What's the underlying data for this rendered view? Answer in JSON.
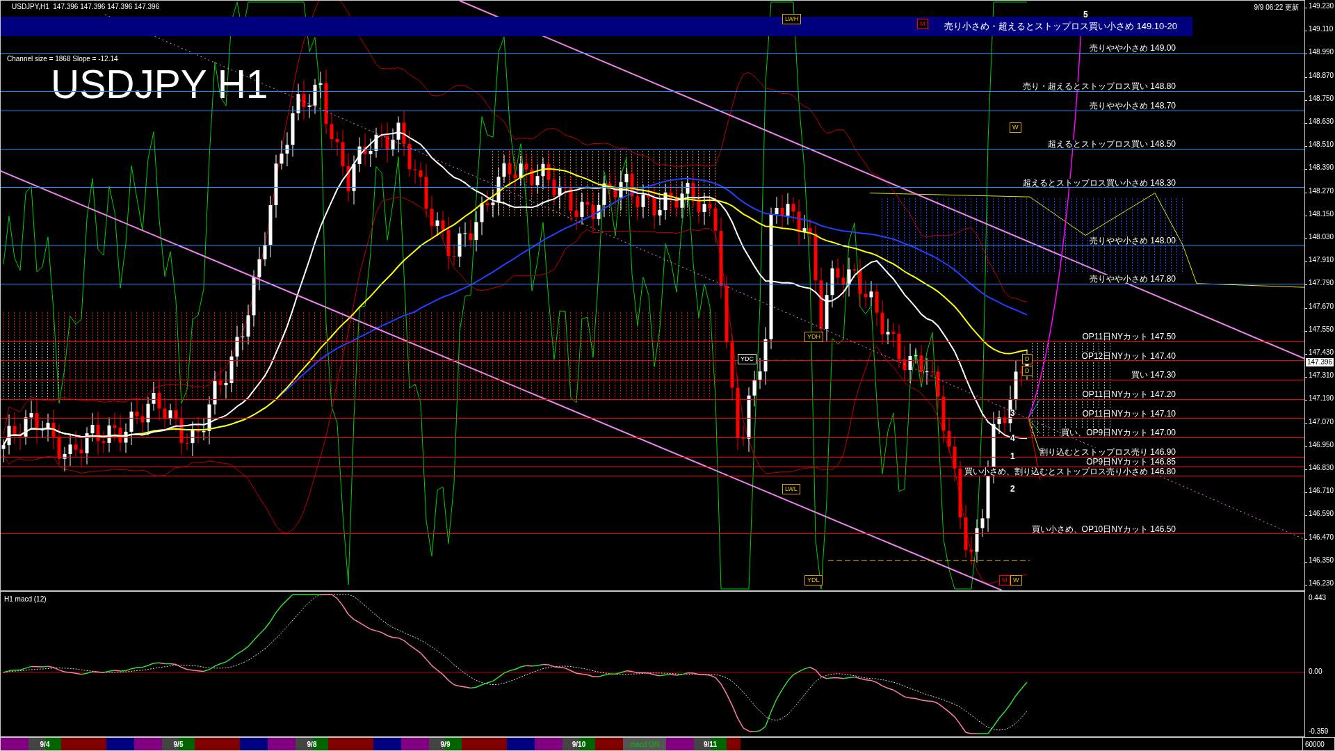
{
  "header": {
    "symbol_info": "USDJPY,H1  147.396 147.396 147.396 147.396",
    "updated": "9/9 06:22 更新"
  },
  "main_chart": {
    "channel_info": "Channel size = 1868 Slope = -12.14",
    "title": "USDJPY H1",
    "zone": {
      "label": "売り小さめ・超えるとストップロス買い小さめ",
      "price": "149.10-20"
    },
    "levels": [
      {
        "label": "売りやや小さめ",
        "price": "149.00",
        "color": "#1e90ff"
      },
      {
        "label": "売り・超えるとストップロス買い",
        "price": "148.80",
        "color": "#1e90ff"
      },
      {
        "label": "売りやや小さめ",
        "price": "148.70",
        "color": "#1e90ff"
      },
      {
        "label": "超えるとストップロス買い",
        "price": "148.50",
        "color": "#1e90ff"
      },
      {
        "label": "超えるとストップロス買い小さめ",
        "price": "148.30",
        "color": "#1e90ff"
      },
      {
        "label": "売りやや小さめ",
        "price": "148.00",
        "color": "#1e90ff"
      },
      {
        "label": "売りやや小さめ",
        "price": "147.80",
        "color": "#1e90ff"
      },
      {
        "label": "OP11日NYカット",
        "price": "147.50",
        "color": "#ff0000"
      },
      {
        "label": "OP12日NYカット",
        "price": "147.40",
        "color": "#ff0000"
      },
      {
        "label": "買い",
        "price": "147.30",
        "color": "#ff0000"
      },
      {
        "label": "OP11日NYカット",
        "price": "147.20",
        "color": "#ff0000"
      },
      {
        "label": "OP11日NYカット",
        "price": "147.10",
        "color": "#ff0000"
      },
      {
        "label": "買い、OP9日NYカット",
        "price": "147.00",
        "color": "#ff0000"
      },
      {
        "label": "割り込むとストップロス売り",
        "price": "146.90",
        "color": "#ff0000"
      },
      {
        "label": "OP9日NYカット",
        "price": "146.85",
        "color": "#ff0000"
      },
      {
        "label": "買い小さめ、割り込むとストップロス売り小さめ",
        "price": "146.80",
        "color": "#ff0000"
      },
      {
        "label": "買い小さめ、OP10日NYカット",
        "price": "146.50",
        "color": "#ff0000"
      }
    ],
    "markers": [
      {
        "kind": "box",
        "text": "LWH"
      },
      {
        "kind": "flag",
        "text": "M"
      },
      {
        "kind": "box",
        "text": "W"
      },
      {
        "kind": "note",
        "text": "YDC"
      },
      {
        "kind": "box",
        "text": "YDH"
      },
      {
        "kind": "box",
        "text": "D"
      },
      {
        "kind": "box",
        "text": "D"
      },
      {
        "kind": "box",
        "text": "LWL"
      },
      {
        "kind": "box",
        "text": "YDL"
      },
      {
        "kind": "flag",
        "text": "M"
      },
      {
        "kind": "box",
        "text": "W"
      },
      {
        "kind": "digit",
        "text": "5"
      },
      {
        "kind": "digit",
        "text": "3"
      },
      {
        "kind": "digit",
        "text": "4"
      },
      {
        "kind": "digit",
        "text": "1"
      },
      {
        "kind": "digit",
        "text": "2"
      }
    ],
    "price_axis": [
      "149.230",
      "149.110",
      "148.990",
      "148.870",
      "148.750",
      "148.630",
      "148.510",
      "148.390",
      "148.270",
      "148.150",
      "148.030",
      "147.910",
      "147.790",
      "147.670",
      "147.550",
      "147.430",
      "147.310",
      "147.190",
      "147.070",
      "146.950",
      "146.830",
      "146.710",
      "146.590",
      "146.470",
      "146.350",
      "146.230"
    ],
    "current_price": "147.396"
  },
  "macd_panel": {
    "title": "H1 macd (12)",
    "axis": [
      "0.443",
      "0.00",
      "-0.359"
    ]
  },
  "date_bar": {
    "dates": [
      "9/4",
      "9/5",
      "9/8",
      "9/9",
      "9/10",
      "9/11"
    ],
    "toggle": {
      "label": "macd ON"
    },
    "volume_scale": "60000"
  }
}
